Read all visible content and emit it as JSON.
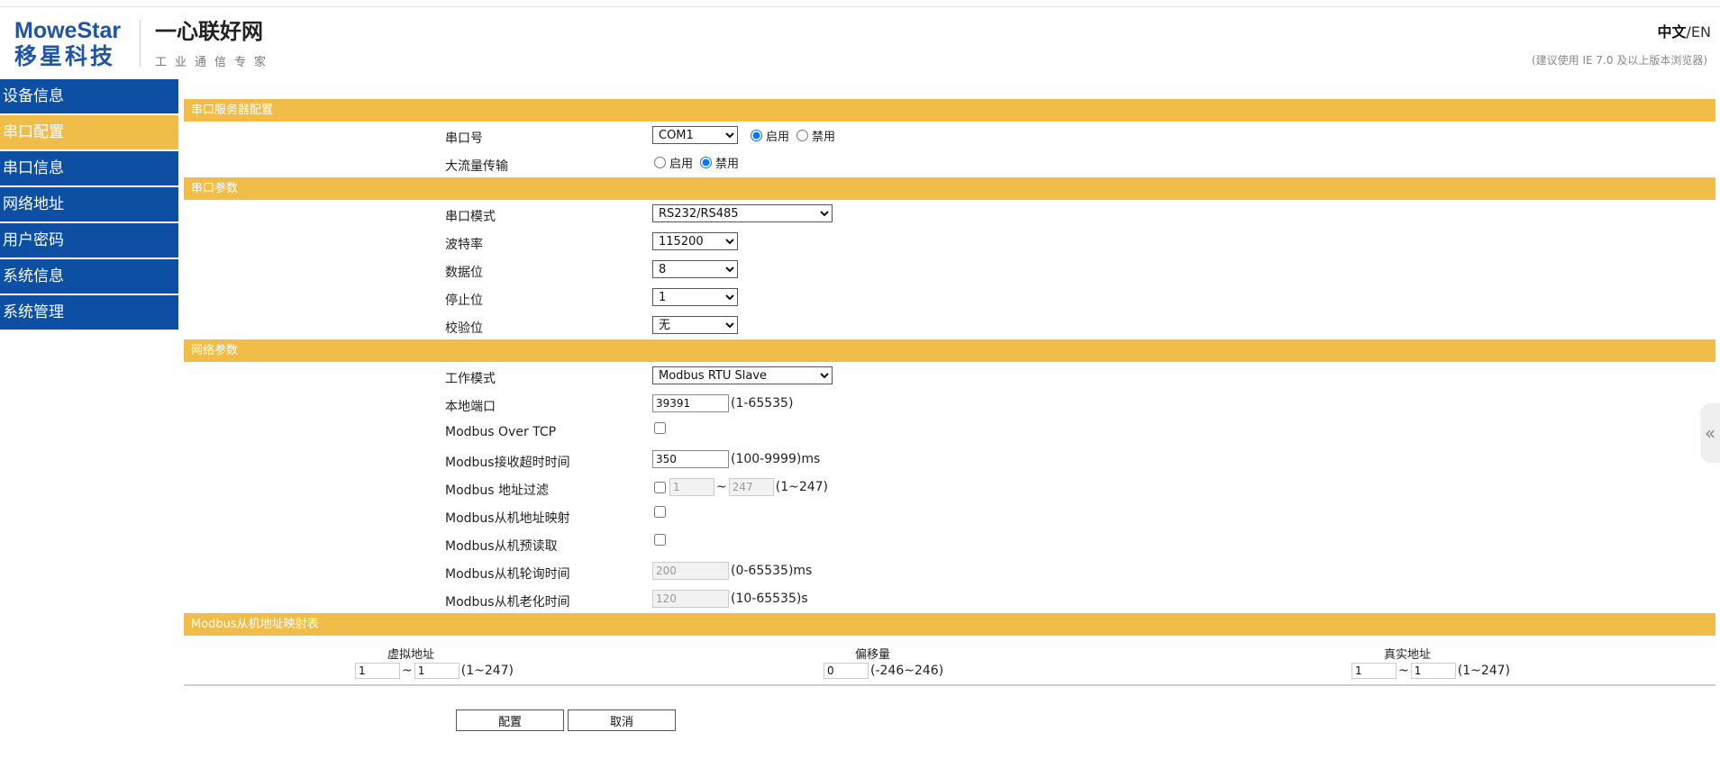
{
  "brand": {
    "logo_en": "MoweStar",
    "logo_cn": "移星科技",
    "slogan": "一心联好网",
    "slogan_sub": "工业通信专家"
  },
  "header": {
    "lang_zh": "中文",
    "lang_sep": "/",
    "lang_en": "EN",
    "browser_tip": "(建议使用 IE 7.0 及以上版本浏览器)"
  },
  "sidebar": {
    "items": [
      {
        "label": "设备信息",
        "active": false
      },
      {
        "label": "串口配置",
        "active": true
      },
      {
        "label": "串口信息",
        "active": false
      },
      {
        "label": "网络地址",
        "active": false
      },
      {
        "label": "用户密码",
        "active": false
      },
      {
        "label": "系统信息",
        "active": false
      },
      {
        "label": "系统管理",
        "active": false
      }
    ]
  },
  "serial_server": {
    "title": "串口服务器配置",
    "port_label": "串口号",
    "port_value": "COM1",
    "enable_label": "启用",
    "disable_label": "禁用",
    "bulk_label": "大流量传输",
    "bulk_enable": "启用",
    "bulk_disable": "禁用"
  },
  "serial_params": {
    "title": "串口参数",
    "mode_label": "串口模式",
    "mode_value": "RS232/RS485",
    "baud_label": "波特率",
    "baud_value": "115200",
    "data_label": "数据位",
    "data_value": "8",
    "stop_label": "停止位",
    "stop_value": "1",
    "parity_label": "校验位",
    "parity_value": "无"
  },
  "net_params": {
    "title": "网络参数",
    "work_mode_label": "工作模式",
    "work_mode_value": "Modbus RTU Slave",
    "local_port_label": "本地端口",
    "local_port_value": "39391",
    "local_port_range": "(1-65535)",
    "over_tcp_label": "Modbus Over TCP",
    "timeout_label": "Modbus接收超时时间",
    "timeout_value": "350",
    "timeout_range": "(100-9999)ms",
    "filter_label": "Modbus 地址过滤",
    "filter_from": "1",
    "filter_tilde": "~",
    "filter_to": "247",
    "filter_range": "(1~247)",
    "slave_map_label": "Modbus从机地址映射",
    "slave_preread_label": "Modbus从机预读取",
    "poll_label": "Modbus从机轮询时间",
    "poll_value": "200",
    "poll_range": "(0-65535)ms",
    "aging_label": "Modbus从机老化时间",
    "aging_value": "120",
    "aging_range": "(10-65535)s"
  },
  "map_table": {
    "title": "Modbus从机地址映射表",
    "col_virtual": "虚拟地址",
    "col_offset": "偏移量",
    "col_real": "真实地址",
    "virtual_from": "1",
    "virtual_to": "1",
    "virtual_range": "(1~247)",
    "offset_value": "0",
    "offset_range": "(-246~246)",
    "real_from": "1",
    "real_to": "1",
    "real_range": "(1~247)",
    "tilde": "~"
  },
  "buttons": {
    "apply": "配置",
    "cancel": "取消"
  },
  "icons": {
    "side_tab": "double-chevron-left-icon"
  },
  "colors": {
    "nav_blue": "#0d4fa3",
    "accent_yellow": "#f0bd49",
    "logo_blue": "#2055a6"
  }
}
